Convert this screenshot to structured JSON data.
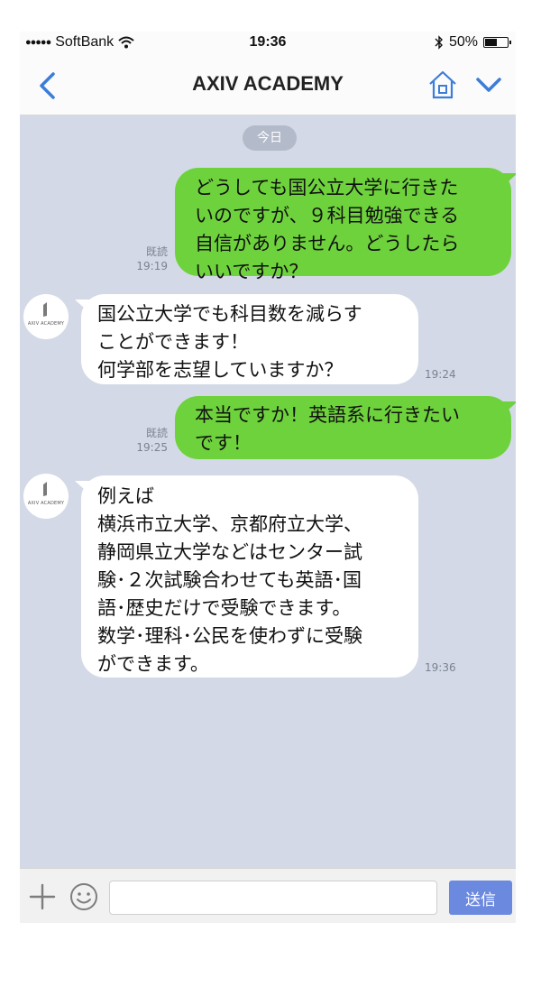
{
  "status_bar": {
    "carrier": "SoftBank",
    "time": "19:36",
    "battery": "50%"
  },
  "header": {
    "title": "AXIV ACADEMY"
  },
  "chat": {
    "date_label": "今日",
    "read_label": "既読",
    "contact_avatar_text": "AXIV ACADEMY",
    "messages": [
      {
        "sender": "me",
        "lines": [
          "どうしても国公立大学に行きた",
          "いのですが、９科目勉強できる",
          "自信がありません。どうしたら",
          "いいですか？"
        ],
        "time": "19:19"
      },
      {
        "sender": "other",
        "lines": [
          "国公立大学でも科目数を減らす",
          "ことができます！",
          "何学部を志望していますか？"
        ],
        "time": "19:24"
      },
      {
        "sender": "me",
        "lines": [
          "本当ですか！英語系に行きたい",
          "です！"
        ],
        "time": "19:25"
      },
      {
        "sender": "other",
        "lines": [
          "例えば",
          "横浜市立大学、京都府立大学、",
          "静岡県立大学などはセンター試",
          "験･２次試験合わせても英語･国",
          "語･歴史だけで受験できます。",
          "数学･理科･公民を使わずに受験",
          "ができます。"
        ],
        "time": "19:36"
      }
    ]
  },
  "input_bar": {
    "placeholder": "",
    "send_label": "送信"
  },
  "colors": {
    "my_bubble": "#6ed23c",
    "their_bubble": "#ffffff",
    "chat_background": "#d3d9e6",
    "send_button": "#6c89e0",
    "accent_blue": "#3b7dd8"
  }
}
